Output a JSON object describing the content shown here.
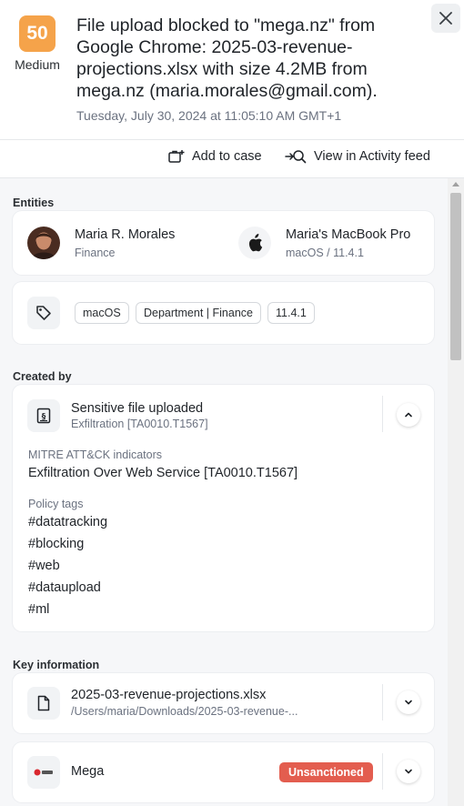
{
  "header": {
    "score": "50",
    "severity": "Medium",
    "title": "File upload blocked to \"mega.nz\" from Google Chrome: 2025-03-revenue-projections.xlsx with size 4.2MB from mega.nz (maria.morales@gmail.com).",
    "timestamp": "Tuesday, July 30, 2024 at 11:05:10 AM GMT+1",
    "score_color": "#f5a34a"
  },
  "actions": {
    "add_to_case": "Add to case",
    "view_activity": "View in Activity feed"
  },
  "entities": {
    "label": "Entities",
    "user": {
      "name": "Maria R. Morales",
      "department": "Finance"
    },
    "device": {
      "name": "Maria's MacBook Pro",
      "os": "macOS / 11.4.1"
    },
    "tags": [
      "macOS",
      "Department | Finance",
      "11.4.1"
    ]
  },
  "created_by": {
    "label": "Created by",
    "title": "Sensitive file uploaded",
    "subtitle": "Exfiltration [TA0010.T1567]",
    "mitre_label": "MITRE ATT&CK indicators",
    "mitre_value": "Exfiltration Over Web Service [TA0010.T1567]",
    "policy_label": "Policy tags",
    "policy_tags": [
      "#datatracking",
      "#blocking",
      "#web",
      "#dataupload",
      "#ml"
    ]
  },
  "key_info": {
    "label": "Key information",
    "file": {
      "name": "2025-03-revenue-projections.xlsx",
      "path": "/Users/maria/Downloads/2025-03-revenue-..."
    },
    "destination": {
      "name": "Mega",
      "badge": "Unsanctioned",
      "badge_color": "#e35d4f"
    }
  }
}
